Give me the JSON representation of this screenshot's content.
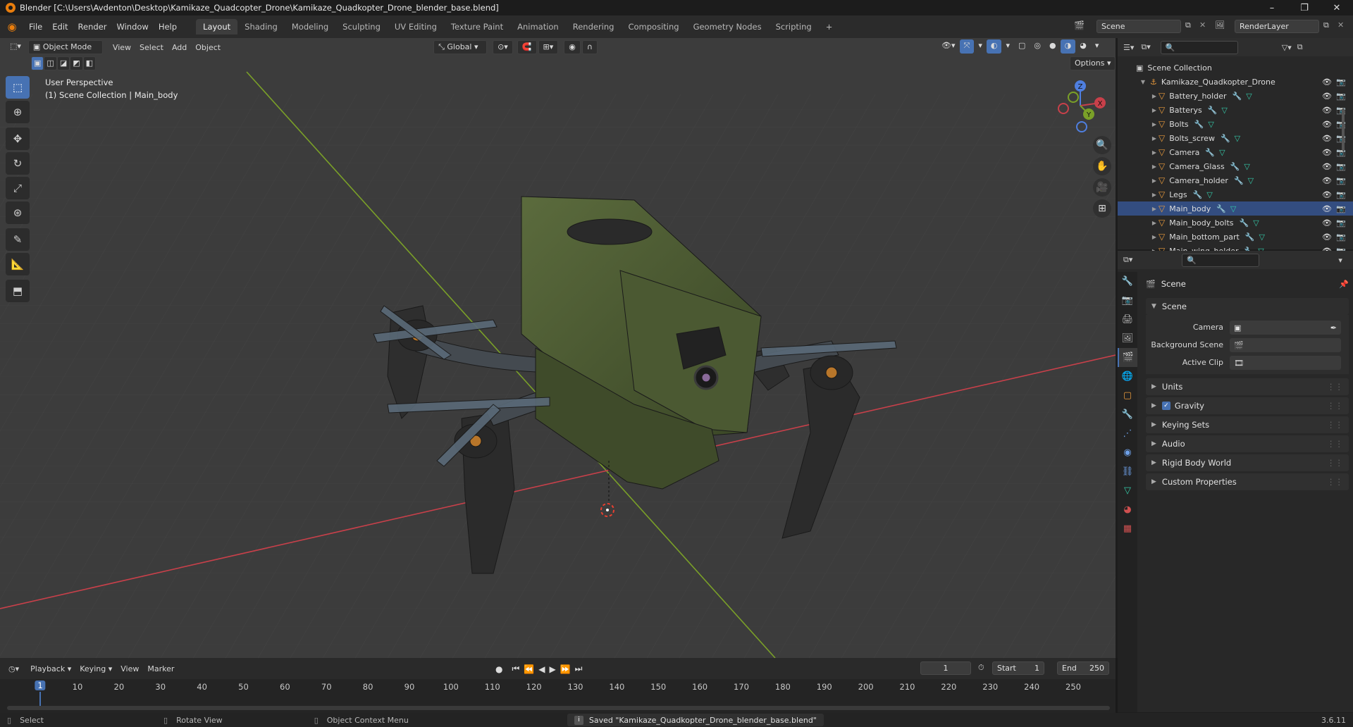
{
  "window": {
    "title": "Blender [C:\\Users\\Avdenton\\Desktop\\Kamikaze_Quadcopter_Drone\\Kamikaze_Quadkopter_Drone_blender_base.blend]",
    "minimize": "–",
    "maximize": "❐",
    "close": "✕"
  },
  "menus": [
    "File",
    "Edit",
    "Render",
    "Window",
    "Help"
  ],
  "workspaces": [
    "Layout",
    "Shading",
    "Modeling",
    "Sculpting",
    "UV Editing",
    "Texture Paint",
    "Animation",
    "Rendering",
    "Compositing",
    "Geometry Nodes",
    "Scripting"
  ],
  "workspace_add": "+",
  "scene_field": "Scene",
  "renderlayer_field": "RenderLayer",
  "viewport": {
    "mode": "Object Mode",
    "menus": [
      "View",
      "Select",
      "Add",
      "Object"
    ],
    "transform_orientation": "Global",
    "options_label": "Options",
    "info_line1": "User Perspective",
    "info_line2": "(1) Scene Collection | Main_body",
    "gizmo_axes": [
      "X",
      "Y",
      "Z"
    ]
  },
  "outliner": {
    "root": "Scene Collection",
    "collection": "Kamikaze_Quadkopter_Drone",
    "objects": [
      "Battery_holder",
      "Batterys",
      "Bolts",
      "Bolts_screw",
      "Camera",
      "Camera_Glass",
      "Camera_holder",
      "Legs",
      "Main_body",
      "Main_body_bolts",
      "Main_bottom_part",
      "Main_wing_holder"
    ],
    "selected": "Main_body"
  },
  "properties": {
    "context_title": "Scene",
    "section_scene": "Scene",
    "camera_label": "Camera",
    "background_scene_label": "Background Scene",
    "active_clip_label": "Active Clip",
    "panels": [
      "Units",
      "Gravity",
      "Keying Sets",
      "Audio",
      "Rigid Body World",
      "Custom Properties"
    ],
    "gravity_checked": true
  },
  "timeline": {
    "menus": [
      "Playback",
      "Keying",
      "View",
      "Marker"
    ],
    "current_frame": "1",
    "start_label": "Start",
    "start_value": "1",
    "end_label": "End",
    "end_value": "250",
    "frame_marks": [
      "10",
      "20",
      "30",
      "40",
      "50",
      "60",
      "70",
      "80",
      "90",
      "100",
      "110",
      "120",
      "130",
      "140",
      "150",
      "160",
      "170",
      "180",
      "190",
      "200",
      "210",
      "220",
      "230",
      "240",
      "250"
    ],
    "playhead": "1"
  },
  "status": {
    "select": "Select",
    "rotate": "Rotate View",
    "context_menu": "Object Context Menu",
    "message": "Saved \"Kamikaze_Quadkopter_Drone_blender_base.blend\"",
    "version": "3.6.11"
  },
  "colors": {
    "accent": "#4772b3",
    "body_green": "#4a5a32",
    "object_orange": "#e89a3c",
    "x_axis": "#c8404a",
    "y_axis": "#7aa028",
    "z_axis": "#4f7fe0"
  }
}
